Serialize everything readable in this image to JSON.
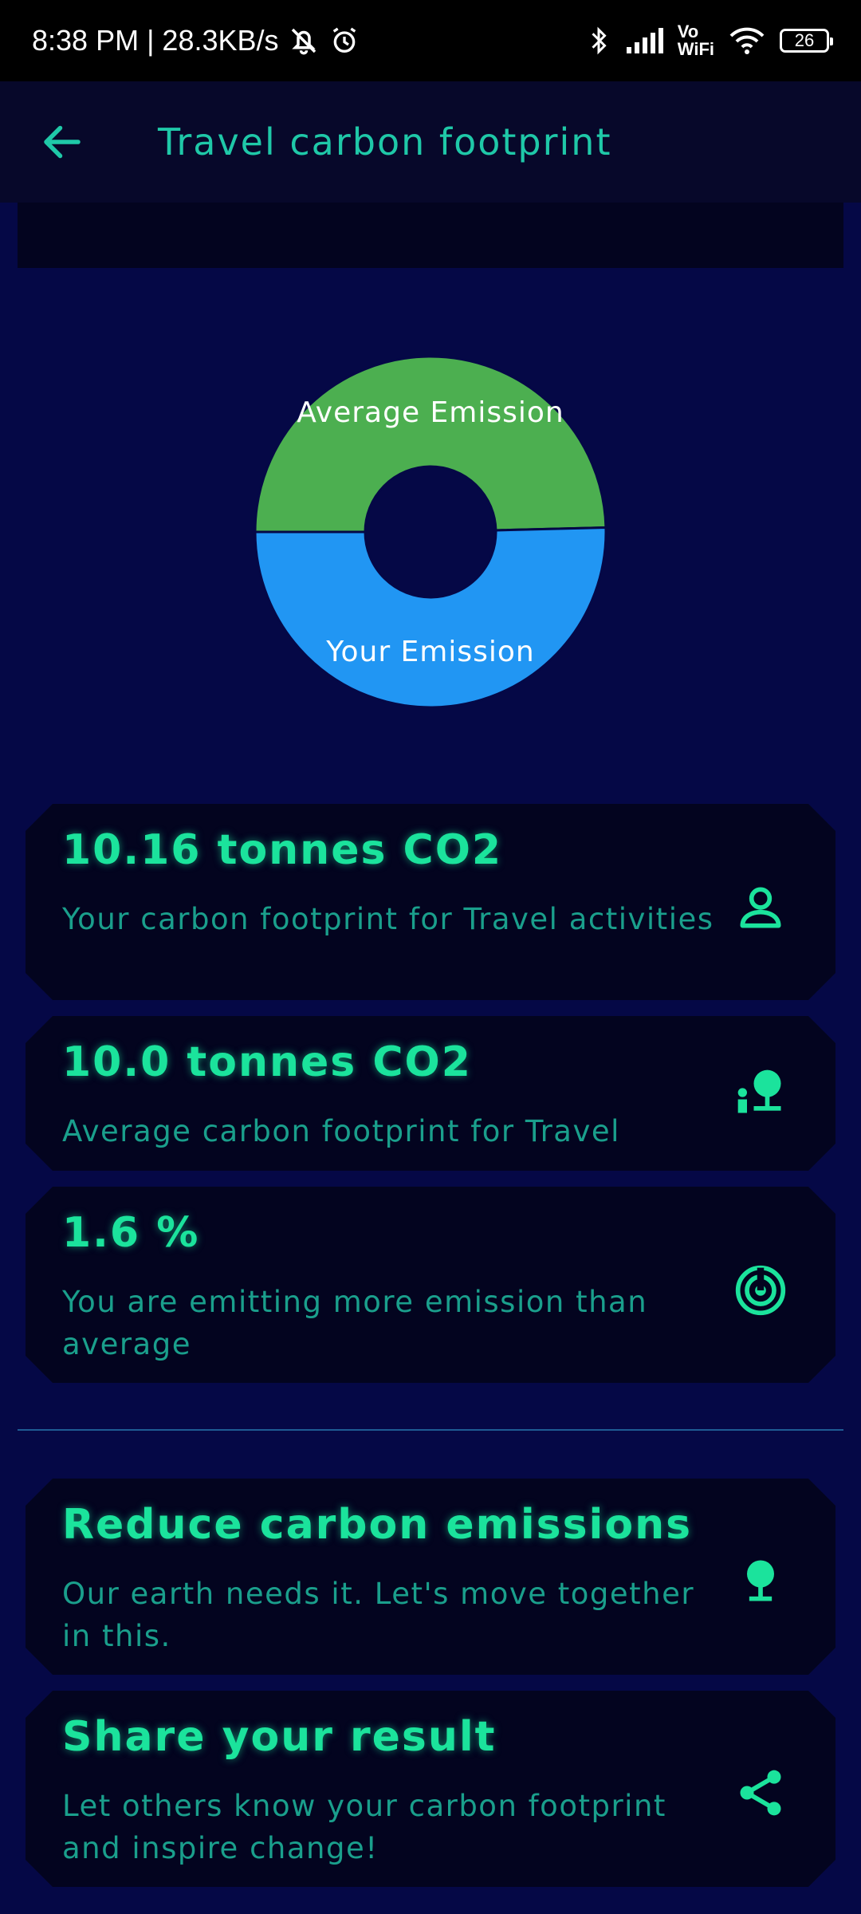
{
  "status_bar": {
    "time": "8:38 PM | 28.3KB/s",
    "network_label_top": "Vo",
    "network_label_bottom": "WiFi",
    "battery": "26"
  },
  "app_bar": {
    "back_icon": "arrow-left-icon",
    "title": "Travel carbon footprint"
  },
  "colors": {
    "accent": "#1be39c",
    "teal_text": "#1a9f8c",
    "average_slice": "#4caf50",
    "your_slice": "#2196f3",
    "background": "#050846",
    "card": "#03041f"
  },
  "chart_data": {
    "type": "pie",
    "categories": [
      "Average Emission",
      "Your Emission"
    ],
    "values": [
      10.0,
      10.16
    ],
    "colors": [
      "#4caf50",
      "#2196f3"
    ],
    "donut": true
  },
  "stats": [
    {
      "value": "10.16 tonnes CO2",
      "description": "Your carbon footprint for Travel activities",
      "icon": "person-icon"
    },
    {
      "value": "10.0 tonnes CO2",
      "description": "Average carbon footprint for Travel",
      "icon": "person-tree-icon"
    },
    {
      "value": "1.6 %",
      "description": "You are emitting more emission than average",
      "icon": "radar-icon"
    }
  ],
  "actions": [
    {
      "title": "Reduce carbon emissions",
      "description": "Our earth needs it. Let's move together in this.",
      "icon": "tree-icon"
    },
    {
      "title": "Share your result",
      "description": "Let others know your carbon footprint and inspire change!",
      "icon": "share-icon"
    }
  ]
}
